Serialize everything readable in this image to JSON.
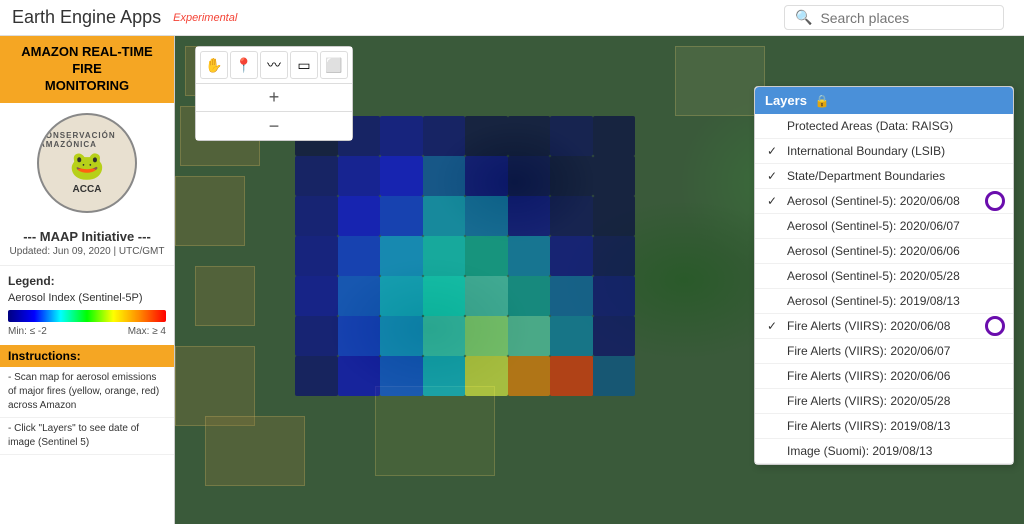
{
  "header": {
    "title": "Earth Engine Apps",
    "experimental_label": "Experimental",
    "search_placeholder": "Search places"
  },
  "sidebar": {
    "app_title": "AMAZON REAL-TIME FIRE\nMONITORING",
    "logo_text_top": "CONSERVACIÓN AMAZÓNICA",
    "logo_frog": "🐸",
    "logo_text_bottom": "ACCA",
    "maap_title": "--- MAAP Initiative ---",
    "updated_text": "Updated: Jun 09, 2020 | UTC/GMT",
    "legend_header": "Legend:",
    "legend_label": "Aerosol Index (Sentinel-5P)",
    "color_min": "Min: ≤ -2",
    "color_max": "Max: ≥ 4",
    "instructions_header": "Instructions:",
    "instructions": [
      "- Scan map for aerosol emissions of major fires (yellow, orange, red) across Amazon",
      "- Click \"Layers\" to see date of image (Sentinel 5)"
    ]
  },
  "toolbar": {
    "tools": [
      "✋",
      "📍",
      "〰",
      "▭",
      "⬜"
    ],
    "zoom_in": "+",
    "zoom_out": "−"
  },
  "layers_panel": {
    "header": "Layers",
    "lock_icon": "🔒",
    "layers": [
      {
        "name": "Protected Areas (Data: RAISG)",
        "checked": false
      },
      {
        "name": "International Boundary (LSIB)",
        "checked": true
      },
      {
        "name": "State/Department Boundaries",
        "checked": true
      },
      {
        "name": "Aerosol (Sentinel-5): 2020/06/08",
        "checked": true,
        "has_circle": true
      },
      {
        "name": "Aerosol (Sentinel-5): 2020/06/07",
        "checked": false
      },
      {
        "name": "Aerosol (Sentinel-5): 2020/06/06",
        "checked": false
      },
      {
        "name": "Aerosol (Sentinel-5): 2020/05/28",
        "checked": false
      },
      {
        "name": "Aerosol (Sentinel-5): 2019/08/13",
        "checked": false
      },
      {
        "name": "Fire Alerts (VIIRS): 2020/06/08",
        "checked": true,
        "has_circle": true
      },
      {
        "name": "Fire Alerts (VIIRS): 2020/06/07",
        "checked": false
      },
      {
        "name": "Fire Alerts (VIIRS): 2020/06/06",
        "checked": false
      },
      {
        "name": "Fire Alerts (VIIRS): 2020/05/28",
        "checked": false
      },
      {
        "name": "Fire Alerts (VIIRS): 2019/08/13",
        "checked": false
      },
      {
        "name": "Image (Suomi): 2019/08/13",
        "checked": false
      }
    ]
  },
  "heatmap_colors": [
    "#000044",
    "#000080",
    "#0000aa",
    "#000080",
    "#000044",
    "#000044",
    "#000060",
    "#000044",
    "#000080",
    "#0000cc",
    "#0000ff",
    "#0055bb",
    "#000099",
    "#000060",
    "#000044",
    "#000044",
    "#000099",
    "#0000ff",
    "#0033ff",
    "#00aadd",
    "#0077cc",
    "#000099",
    "#000060",
    "#000044",
    "#0000aa",
    "#0033ff",
    "#00aaff",
    "#00dddd",
    "#00bbaa",
    "#0088cc",
    "#000099",
    "#000060",
    "#0000bb",
    "#0055ff",
    "#00ccff",
    "#00ffee",
    "#44ddcc",
    "#00aaaa",
    "#0066bb",
    "#000088",
    "#000099",
    "#0033ff",
    "#00aaff",
    "#33eedd",
    "#99ff88",
    "#55ddbb",
    "#0088bb",
    "#000077",
    "#000077",
    "#0000dd",
    "#0055ff",
    "#00ccee",
    "#eeff44",
    "#ff8800",
    "#ff3300",
    "#005599",
    "#000055",
    "#0000aa",
    "#0000ff",
    "#00aadd",
    "#aaff44",
    "#ff6600",
    "#cc2200",
    "#003377",
    "#000044",
    "#000080",
    "#0000cc",
    "#0055bb",
    "#44cc44",
    "#ffaa00",
    "#883300",
    "#002244",
    "#000033",
    "#000055",
    "#000099",
    "#0000cc",
    "#006622",
    "#cc7700",
    "#553300",
    "#001133",
    "#000022",
    "#000033",
    "#000055",
    "#000077",
    "#000055",
    "#444422",
    "#332200",
    "#000011"
  ]
}
